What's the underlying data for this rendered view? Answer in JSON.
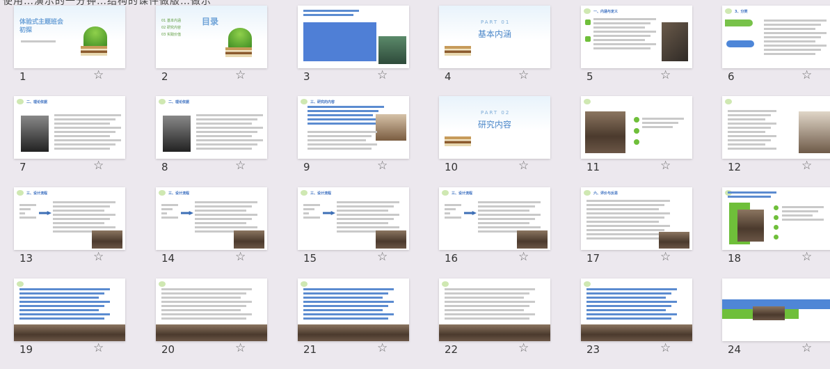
{
  "header": {
    "partial_text": "使用…演示的一分钟…结构的课件做版…做示"
  },
  "colors": {
    "accent_blue": "#5b8bd0",
    "accent_green": "#6fbf3a",
    "bg": "#ece8ee"
  },
  "slides": [
    {
      "num": "1",
      "title": "体验式主题班会初探"
    },
    {
      "num": "2",
      "title": "目录",
      "items": [
        "01 基本内涵",
        "02 研究内容",
        "03 实践价值"
      ]
    },
    {
      "num": "3",
      "title": ""
    },
    {
      "num": "4",
      "title": "基本内涵",
      "part": "PART 01"
    },
    {
      "num": "5",
      "title": "一、内涵与定义"
    },
    {
      "num": "6",
      "title": "3、分类"
    },
    {
      "num": "7",
      "title": "二、理论依据"
    },
    {
      "num": "8",
      "title": "二、理论依据"
    },
    {
      "num": "9",
      "title": "三、研究的内容"
    },
    {
      "num": "10",
      "title": "研究内容",
      "part": "PART 02"
    },
    {
      "num": "11",
      "title": ""
    },
    {
      "num": "12",
      "title": ""
    },
    {
      "num": "13",
      "title": "三、设计流程"
    },
    {
      "num": "14",
      "title": "三、设计流程"
    },
    {
      "num": "15",
      "title": "三、设计流程"
    },
    {
      "num": "16",
      "title": "三、设计流程"
    },
    {
      "num": "17",
      "title": "六、评价与反思"
    },
    {
      "num": "18",
      "title": ""
    },
    {
      "num": "19",
      "title": ""
    },
    {
      "num": "20",
      "title": ""
    },
    {
      "num": "21",
      "title": ""
    },
    {
      "num": "22",
      "title": ""
    },
    {
      "num": "23",
      "title": ""
    },
    {
      "num": "24",
      "title": ""
    }
  ],
  "star_glyph": "☆"
}
